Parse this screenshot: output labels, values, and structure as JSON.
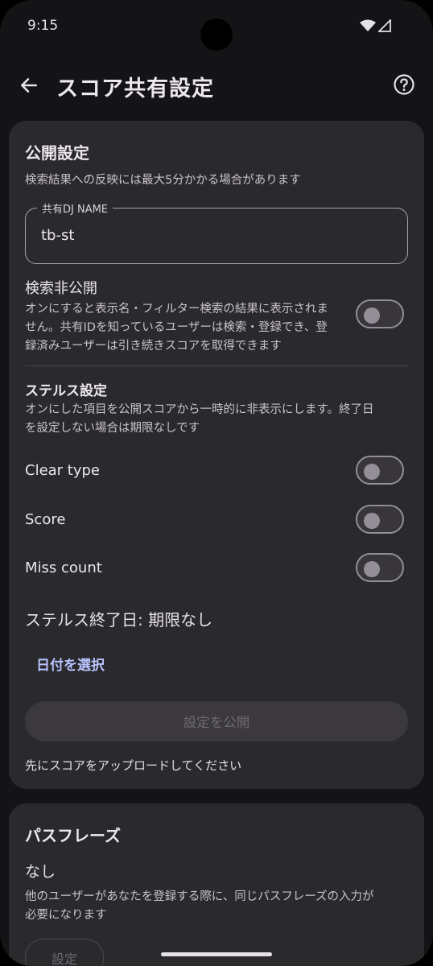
{
  "status_bar": {
    "time": "9:15"
  },
  "app_bar": {
    "title": "スコア共有設定"
  },
  "public_settings": {
    "title": "公開設定",
    "hint": "検索結果への反映には最大5分かかる場合があります",
    "dj_name_field": {
      "label": "共有DJ NAME",
      "value": "tb-st"
    },
    "search_private": {
      "title": "検索非公開",
      "description_lines": [
        "オンにすると表示名・フィルター検索の結果に表示されま",
        "せん。共有IDを知っているユーザーは検索・登録でき、登",
        "録済みユーザーは引き続きスコアを取得できます"
      ],
      "enabled": false
    },
    "stealth": {
      "title": "ステルス設定",
      "description_lines": [
        "オンにした項目を公開スコアから一時的に非表示にします。終了日",
        "を設定しない場合は期限なしです"
      ],
      "items": [
        {
          "label": "Clear type",
          "enabled": false
        },
        {
          "label": "Score",
          "enabled": false
        },
        {
          "label": "Miss count",
          "enabled": false
        }
      ],
      "end_date": "ステルス終了日: 期限なし",
      "select_date_label": "日付を選択"
    },
    "publish_button_label": "設定を公開",
    "upload_note": "先にスコアをアップロードしてください"
  },
  "passphrase": {
    "title": "パスフレーズ",
    "value": "なし",
    "description_lines": [
      "他のユーザーがあなたを登録する際に、同じパスフレーズの入力が",
      "必要になります"
    ],
    "set_button_label": "設定"
  }
}
